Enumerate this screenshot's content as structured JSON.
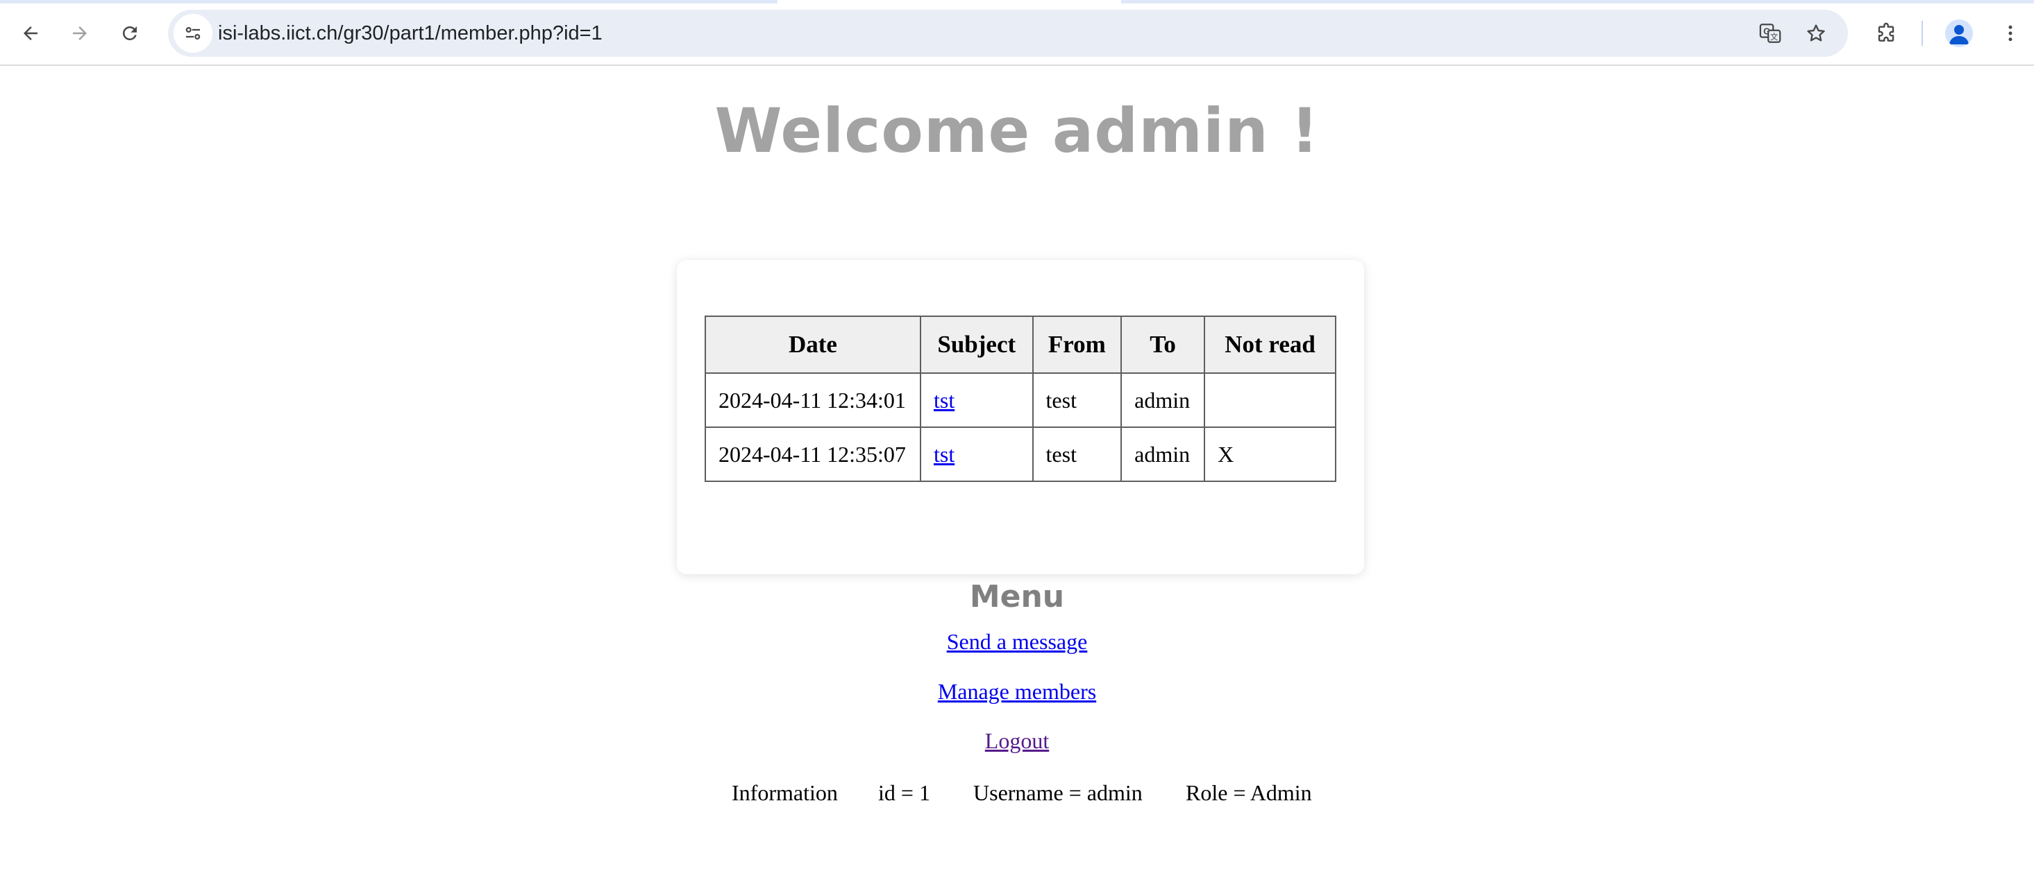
{
  "browser": {
    "url": "isi-labs.iict.ch/gr30/part1/member.php?id=1",
    "accent_color": "#0b57d0"
  },
  "page": {
    "welcome": "Welcome admin !",
    "table": {
      "headers": [
        "Date",
        "Subject",
        "From",
        "To",
        "Not read"
      ],
      "rows": [
        {
          "date": "2024-04-11 12:34:01",
          "subject": "tst",
          "from": "test",
          "to": "admin",
          "not_read": ""
        },
        {
          "date": "2024-04-11 12:35:07",
          "subject": "tst",
          "from": "test",
          "to": "admin",
          "not_read": "X"
        }
      ]
    },
    "menu": {
      "title": "Menu",
      "send_message": "Send a message",
      "manage_members": "Manage members",
      "logout": "Logout"
    },
    "info": {
      "label": "Information",
      "id": "id = 1",
      "username": "Username = admin",
      "role": "Role = Admin"
    }
  }
}
